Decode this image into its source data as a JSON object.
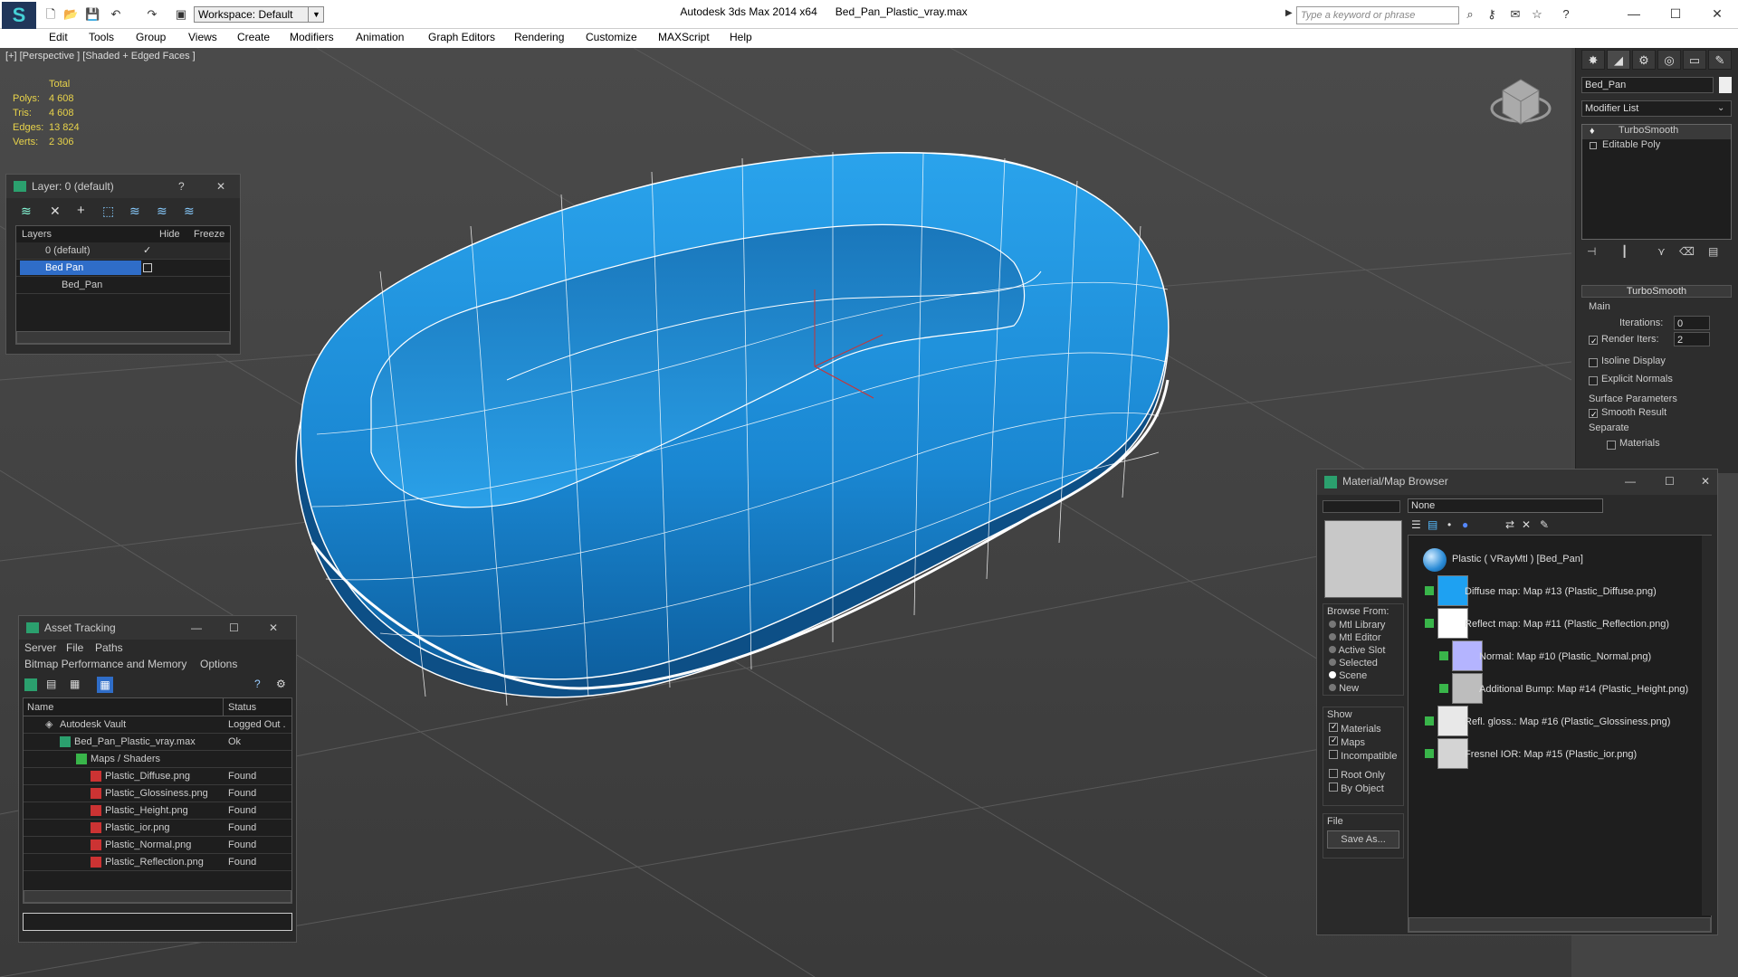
{
  "app": {
    "workspace": "Workspace: Default",
    "title_app": "Autodesk 3ds Max  2014 x64",
    "title_file": "Bed_Pan_Plastic_vray.max",
    "search_placeholder": "Type a keyword or phrase"
  },
  "menu": [
    "Edit",
    "Tools",
    "Group",
    "Views",
    "Create",
    "Modifiers",
    "Animation",
    "Graph Editors",
    "Rendering",
    "Customize",
    "MAXScript",
    "Help"
  ],
  "viewport": {
    "label": "[+] [Perspective ] [Shaded + Edged Faces ]",
    "stats": {
      "header": "Total",
      "rows": [
        {
          "k": "Polys:",
          "v": "4 608"
        },
        {
          "k": "Tris:",
          "v": "4 608"
        },
        {
          "k": "Edges:",
          "v": "13 824"
        },
        {
          "k": "Verts:",
          "v": "2 306"
        }
      ]
    }
  },
  "layer_panel": {
    "title": "Layer: 0 (default)",
    "help": "?",
    "col_layers": "Layers",
    "col_hide": "Hide",
    "col_freeze": "Freeze",
    "rows": [
      {
        "name": "0 (default)"
      },
      {
        "name": "Bed Pan"
      },
      {
        "name": "Bed_Pan"
      }
    ]
  },
  "command_panel": {
    "object_name": "Bed_Pan",
    "modifier_list": "Modifier List",
    "stack": [
      "TurboSmooth",
      "Editable Poly"
    ],
    "rollout_title": "TurboSmooth",
    "main": "Main",
    "iterations_label": "Iterations:",
    "iterations_value": "0",
    "render_iters_label": "Render Iters:",
    "render_iters_value": "2",
    "isoline": "Isoline Display",
    "explicit": "Explicit Normals",
    "surface": "Surface Parameters",
    "smooth": "Smooth Result",
    "separate": "Separate",
    "materials": "Materials"
  },
  "asset_tracking": {
    "title": "Asset Tracking",
    "menu1": [
      "Server",
      "File",
      "Paths"
    ],
    "menu2": [
      "Bitmap Performance and Memory",
      "Options"
    ],
    "col_name": "Name",
    "col_status": "Status",
    "rows": [
      {
        "name": "Autodesk Vault",
        "status": "Logged Out ."
      },
      {
        "name": "Bed_Pan_Plastic_vray.max",
        "status": "Ok"
      },
      {
        "name": "Maps / Shaders",
        "status": ""
      },
      {
        "name": "Plastic_Diffuse.png",
        "status": "Found"
      },
      {
        "name": "Plastic_Glossiness.png",
        "status": "Found"
      },
      {
        "name": "Plastic_Height.png",
        "status": "Found"
      },
      {
        "name": "Plastic_ior.png",
        "status": "Found"
      },
      {
        "name": "Plastic_Normal.png",
        "status": "Found"
      },
      {
        "name": "Plastic_Reflection.png",
        "status": "Found"
      }
    ]
  },
  "material_browser": {
    "title": "Material/Map Browser",
    "search_value": "None",
    "browse_from": "Browse From:",
    "browse_opts": [
      "Mtl Library",
      "Mtl Editor",
      "Active Slot",
      "Selected",
      "Scene",
      "New"
    ],
    "show": "Show",
    "show_opts": [
      "Materials",
      "Maps",
      "Incompatible"
    ],
    "root_only": "Root Only",
    "by_object": "By Object",
    "file": "File",
    "save_as": "Save As...",
    "tree": [
      {
        "label": "Plastic  ( VRayMtl )  [Bed_Pan]",
        "color": "#2a8bd6"
      },
      {
        "label": "Diffuse map: Map #13 (Plastic_Diffuse.png)",
        "color": "#1ea1f2"
      },
      {
        "label": "Reflect map: Map #11 (Plastic_Reflection.png)",
        "color": "#ffffff"
      },
      {
        "label": "Normal: Map #10 (Plastic_Normal.png)",
        "color": "#b4b4ff"
      },
      {
        "label": "Additional Bump: Map #14 (Plastic_Height.png)",
        "color": "#bdbdbd"
      },
      {
        "label": "Refl. gloss.: Map #16 (Plastic_Glossiness.png)",
        "color": "#e8e8e8"
      },
      {
        "label": "Fresnel IOR: Map #15 (Plastic_ior.png)",
        "color": "#d4d4d4"
      }
    ]
  }
}
